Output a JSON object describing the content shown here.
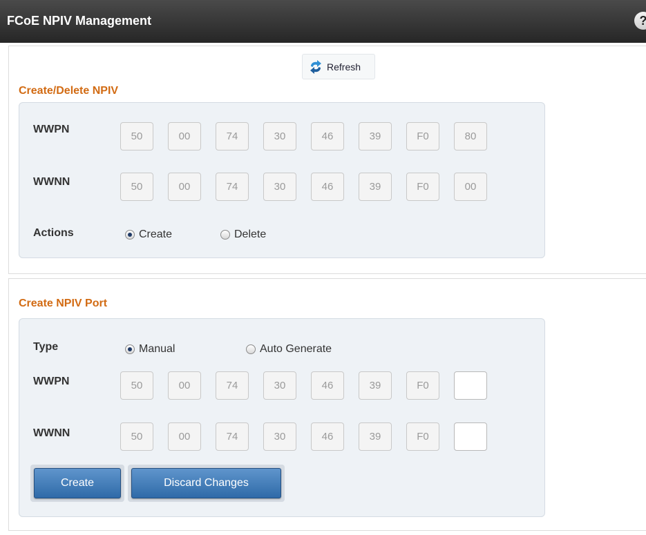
{
  "header": {
    "title": "FCoE NPIV Management",
    "help_label": "?"
  },
  "toolbar": {
    "refresh_label": "Refresh"
  },
  "create_delete": {
    "section_title": "Create/Delete NPIV",
    "wwpn_label": "WWPN",
    "wwpn": [
      "50",
      "00",
      "74",
      "30",
      "46",
      "39",
      "F0",
      "80"
    ],
    "wwnn_label": "WWNN",
    "wwnn": [
      "50",
      "00",
      "74",
      "30",
      "46",
      "39",
      "F0",
      "00"
    ],
    "actions_label": "Actions",
    "action_options": [
      "Create",
      "Delete"
    ],
    "selected_action": "Create"
  },
  "create_port": {
    "section_title": "Create NPIV Port",
    "type_label": "Type",
    "type_options": [
      "Manual",
      "Auto Generate"
    ],
    "selected_type": "Manual",
    "wwpn_label": "WWPN",
    "wwpn": [
      "50",
      "00",
      "74",
      "30",
      "46",
      "39",
      "F0",
      ""
    ],
    "wwnn_label": "WWNN",
    "wwnn": [
      "50",
      "00",
      "74",
      "30",
      "46",
      "39",
      "F0",
      ""
    ],
    "create_label": "Create",
    "discard_label": "Discard Changes"
  }
}
